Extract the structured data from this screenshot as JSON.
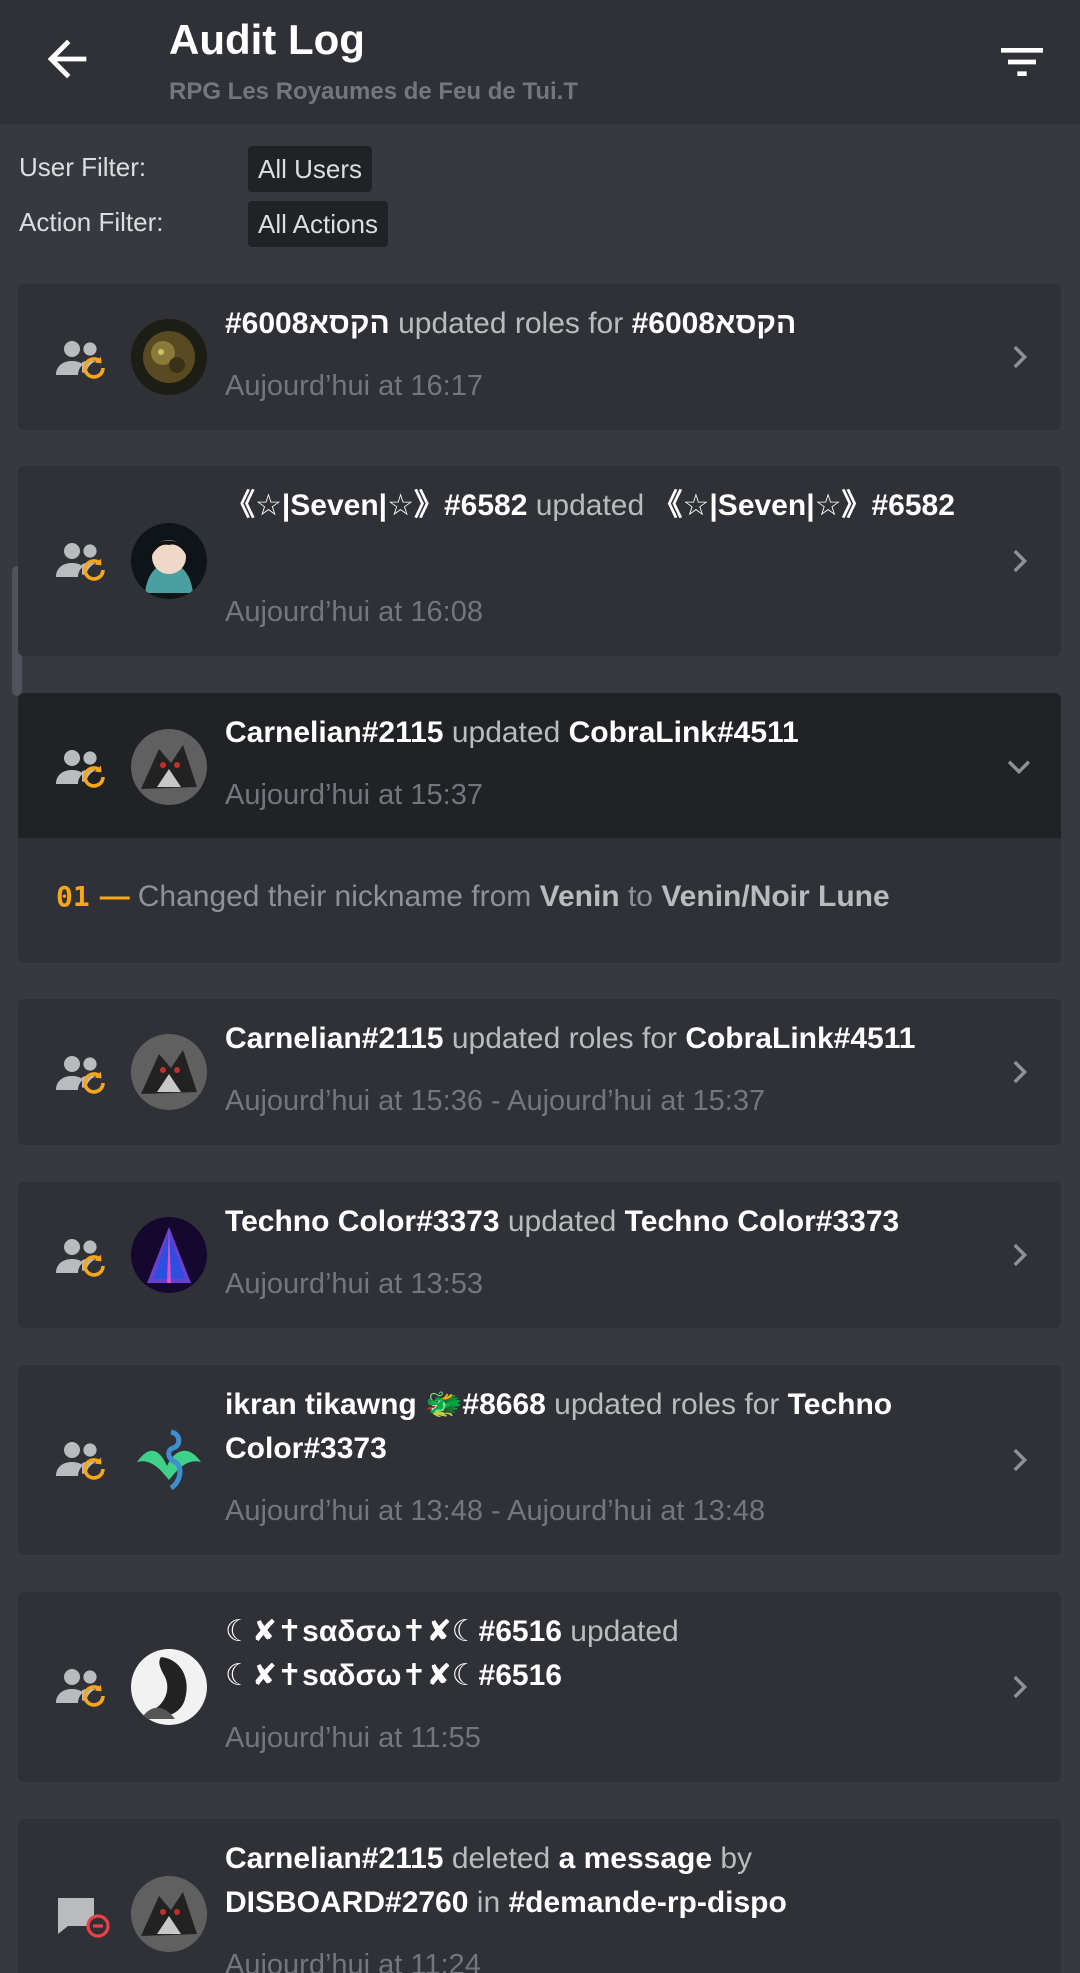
{
  "header": {
    "title": "Audit Log",
    "subtitle": "RPG Les Royaumes de Feu de Tui.T",
    "back_icon": "arrow-left-icon",
    "filter_icon": "filter-lines-icon"
  },
  "filters": {
    "user_label": "User Filter:",
    "user_value": "All Users",
    "action_label": "Action Filter:",
    "action_value": "All Actions"
  },
  "colors": {
    "background": "#36393f",
    "card": "#2f3136",
    "expanded": "#202225",
    "accent_orange": "#faa61a",
    "deleted_red": "#ed4245"
  },
  "entries": [
    {
      "parts": [
        "#6008הקסא",
        " updated roles for ",
        "הקסא#6008"
      ],
      "time": "Aujourd’hui at 16:17",
      "icon": "member-role-update-icon"
    },
    {
      "parts": [
        "《☆|Seven|☆》#6582",
        " updated ",
        "《☆|Seven|☆》#6582"
      ],
      "time": "Aujourd’hui at 16:08",
      "icon": "member-update-icon"
    },
    {
      "parts": [
        "Carnelian#2115",
        " updated ",
        "CobraLink#4511"
      ],
      "time": "Aujourd’hui at 15:37",
      "icon": "member-update-icon",
      "expanded": true,
      "detail": {
        "index": "01",
        "dash": "—",
        "prefix": "Changed their nickname from ",
        "from": "Venin",
        "mid": " to ",
        "to": "Venin/Noir Lune"
      }
    },
    {
      "parts": [
        "Carnelian#2115",
        " updated roles for ",
        "CobraLink#4511"
      ],
      "time": "Aujourd’hui at 15:36 - Aujourd’hui at 15:37",
      "icon": "member-role-update-icon"
    },
    {
      "parts": [
        "Techno Color#3373",
        " updated ",
        "Techno Color#3373"
      ],
      "time": "Aujourd’hui at 13:53",
      "icon": "member-update-icon"
    },
    {
      "parts": [
        "ikran tikawng 🐲#8668",
        " updated roles for ",
        "Techno Color#3373"
      ],
      "time": "Aujourd’hui at 13:48 - Aujourd’hui at 13:48",
      "icon": "member-role-update-icon"
    },
    {
      "parts": [
        "☾✘✝sαδσω✝✘☾#6516",
        " updated ",
        "☾✘✝sαδσω✝✘☾#6516"
      ],
      "time": "Aujourd’hui at 11:55",
      "icon": "member-update-icon"
    },
    {
      "parts": [
        "Carnelian#2115",
        " deleted ",
        "a message",
        " by ",
        "DISBOARD#2760",
        " in ",
        "#demande-rp-dispo"
      ],
      "time": "Aujourd’hui at 11:24",
      "icon": "message-delete-icon"
    }
  ]
}
